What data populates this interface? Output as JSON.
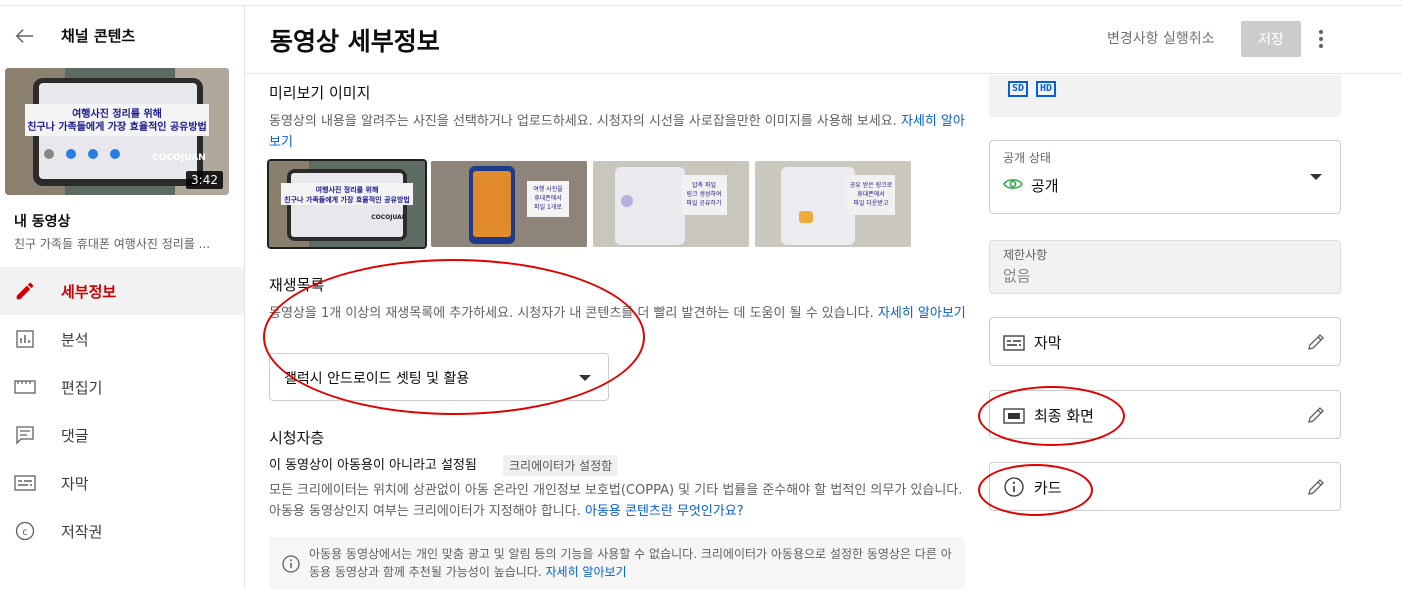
{
  "sidebar": {
    "title": "채널 콘텐츠",
    "video": {
      "title": "내 동영상",
      "description": "친구 가족들 휴대폰 여행사진 정리를 ...",
      "duration": "3:42",
      "thumb_line1": "여행사진 정리를 위해",
      "thumb_line2": "친구나 가족들에게 가장 효율적인 공유방법",
      "thumb_brand": "COCOJUAN"
    },
    "nav": [
      {
        "label": "세부정보",
        "icon": "pencil-icon",
        "active": true
      },
      {
        "label": "분석",
        "icon": "analytics-icon"
      },
      {
        "label": "편집기",
        "icon": "editor-icon"
      },
      {
        "label": "댓글",
        "icon": "comments-icon"
      },
      {
        "label": "자막",
        "icon": "subtitles-icon"
      },
      {
        "label": "저작권",
        "icon": "copyright-icon"
      }
    ]
  },
  "header": {
    "title": "동영상 세부정보",
    "undo_label": "변경사항 실행취소",
    "save_label": "저장"
  },
  "thumbnail_section": {
    "heading": "미리보기 이미지",
    "description": "동영상의 내용을 알려주는 사진을 선택하거나 업로드하세요. 시청자의 시선을 사로잡을만한 이미지를 사용해 보세요.",
    "link": "자세히 알아보기",
    "thumb1_line1": "여행사진 정리를 위해",
    "thumb1_line2": "친구나 가족들에게 가장 효율적인 공유방법",
    "thumb1_brand": "COCOJUAN",
    "thumb2_text": "여행 사진을 휴대폰에서 파일 1개로 압축하자",
    "thumb3_text": "압축 파일 링크 생성하여 파일 공유하기",
    "thumb4_text": "공유 받은 링크로 휴대폰에서 파일 다운받고 압축풀기"
  },
  "playlist_section": {
    "heading": "재생목록",
    "description": "동영상을 1개 이상의 재생목록에 추가하세요. 시청자가 내 콘텐츠를 더 빨리 발견하는 데 도움이 될 수 있습니다.",
    "link": "자세히 알아보기",
    "selected": "갤럭시 안드로이드 셋팅 및 활용"
  },
  "audience_section": {
    "heading": "시청자층",
    "status": "이 동영상이 아동용이 아니라고 설정됨",
    "chip": "크리에이터가 설정함",
    "description": "모든 크리에이터는 위치에 상관없이 아동 온라인 개인정보 보호법(COPPA) 및 기타 법률을 준수해야 할 법적인 의무가 있습니다. 아동용 동영상인지 여부는 크리에이터가 지정해야 합니다.",
    "link": "아동용 콘텐츠란 무엇인가요?",
    "notice": "아동용 동영상에서는 개인 맞춤 광고 및 알림 등의 기능을 사용할 수 없습니다. 크리에이터가 아동용으로 설정한 동영상은 다른 아동용 동영상과 함께 추천될 가능성이 높습니다.",
    "notice_link": "자세히 알아보기"
  },
  "right_panel": {
    "quality_sd": "SD",
    "quality_hd": "HD",
    "visibility_label": "공개 상태",
    "visibility_value": "공개",
    "restrictions_label": "제한사항",
    "restrictions_value": "없음",
    "subtitles": "자막",
    "end_screen": "최종 화면",
    "cards": "카드"
  },
  "colors": {
    "accent_red": "#cc0000",
    "link_blue": "#065fd4",
    "annotation_red": "#e00000",
    "visibility_green": "#2ba640"
  }
}
